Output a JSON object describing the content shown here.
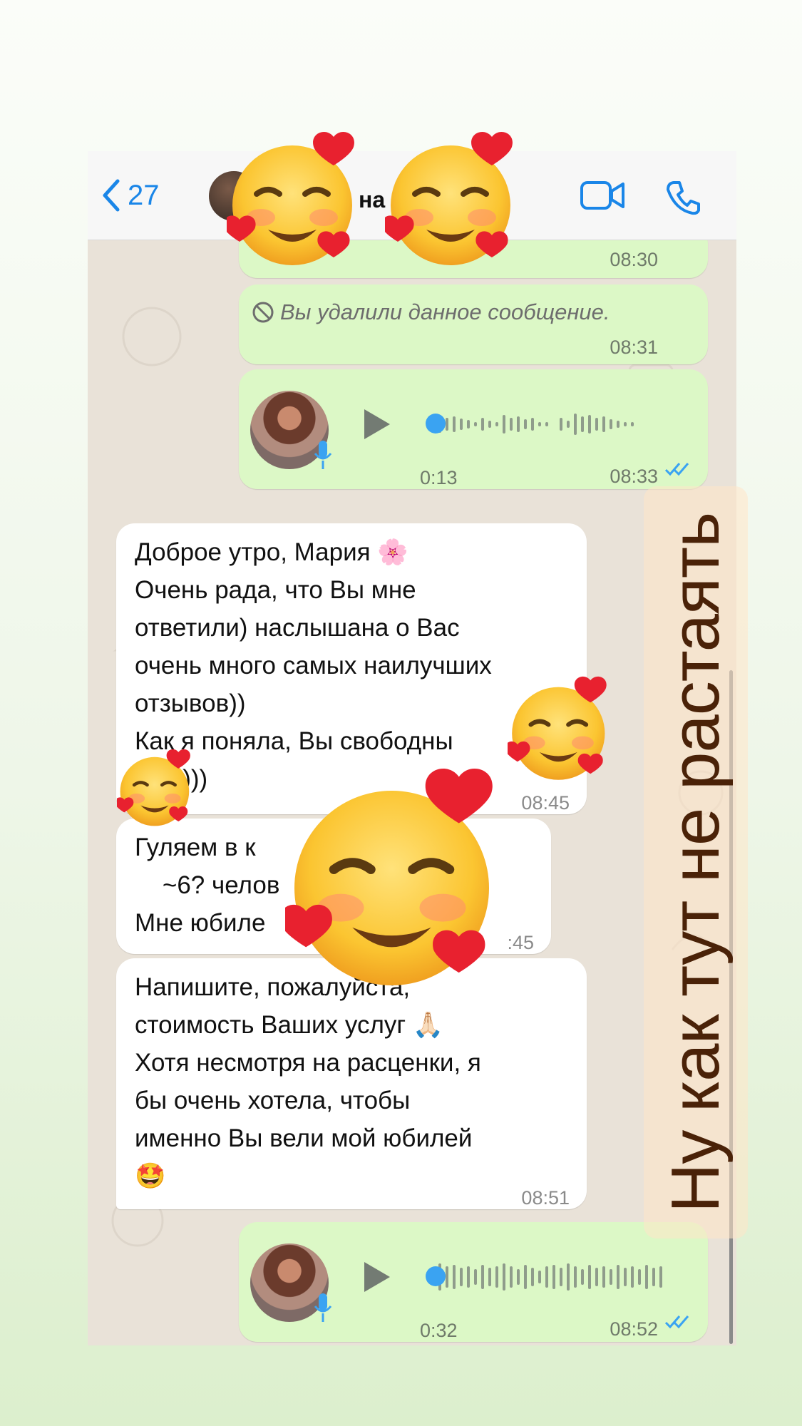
{
  "header": {
    "back_count": "27",
    "contact_name_fragment": "на",
    "icons": [
      "chevron-left-icon",
      "video-camera-icon",
      "phone-icon"
    ]
  },
  "messages": [
    {
      "kind": "out",
      "time": "08:30"
    },
    {
      "kind": "out-deleted",
      "text": "Вы удалили данное сообщение.",
      "time": "08:31"
    },
    {
      "kind": "out-voice",
      "duration": "0:13",
      "time": "08:33"
    },
    {
      "kind": "in",
      "lines": [
        "Доброе утро, Мария 🌸",
        "Очень рада, что Вы мне",
        "ответили) наслышана о Вас",
        "очень много самых наилучших",
        "отзывов))",
        "Как я поняла, Вы свободны",
        "   ря)))"
      ],
      "time": "08:45"
    },
    {
      "kind": "in",
      "lines": [
        "Гуляем в к",
        "    ~6? челов",
        "Мне юбиле"
      ],
      "time": ":45"
    },
    {
      "kind": "in",
      "lines": [
        "Напишите, пожалуйста,",
        "стоимость Ваших услуг 🙏🏻",
        "Хотя несмотря на расценки, я",
        "бы очень хотела, чтобы",
        "именно Вы вели мой юбилей",
        "🤩"
      ],
      "time": "08:51"
    },
    {
      "kind": "out-voice",
      "duration": "0:32",
      "time": "08:52"
    }
  ],
  "overlay_text": "Ну как тут не растаять",
  "colors": {
    "outgoing_bubble": "#dcf8c6",
    "incoming_bubble": "#ffffff",
    "accent_blue": "#1a86e8",
    "banner_text": "#4a2208"
  }
}
